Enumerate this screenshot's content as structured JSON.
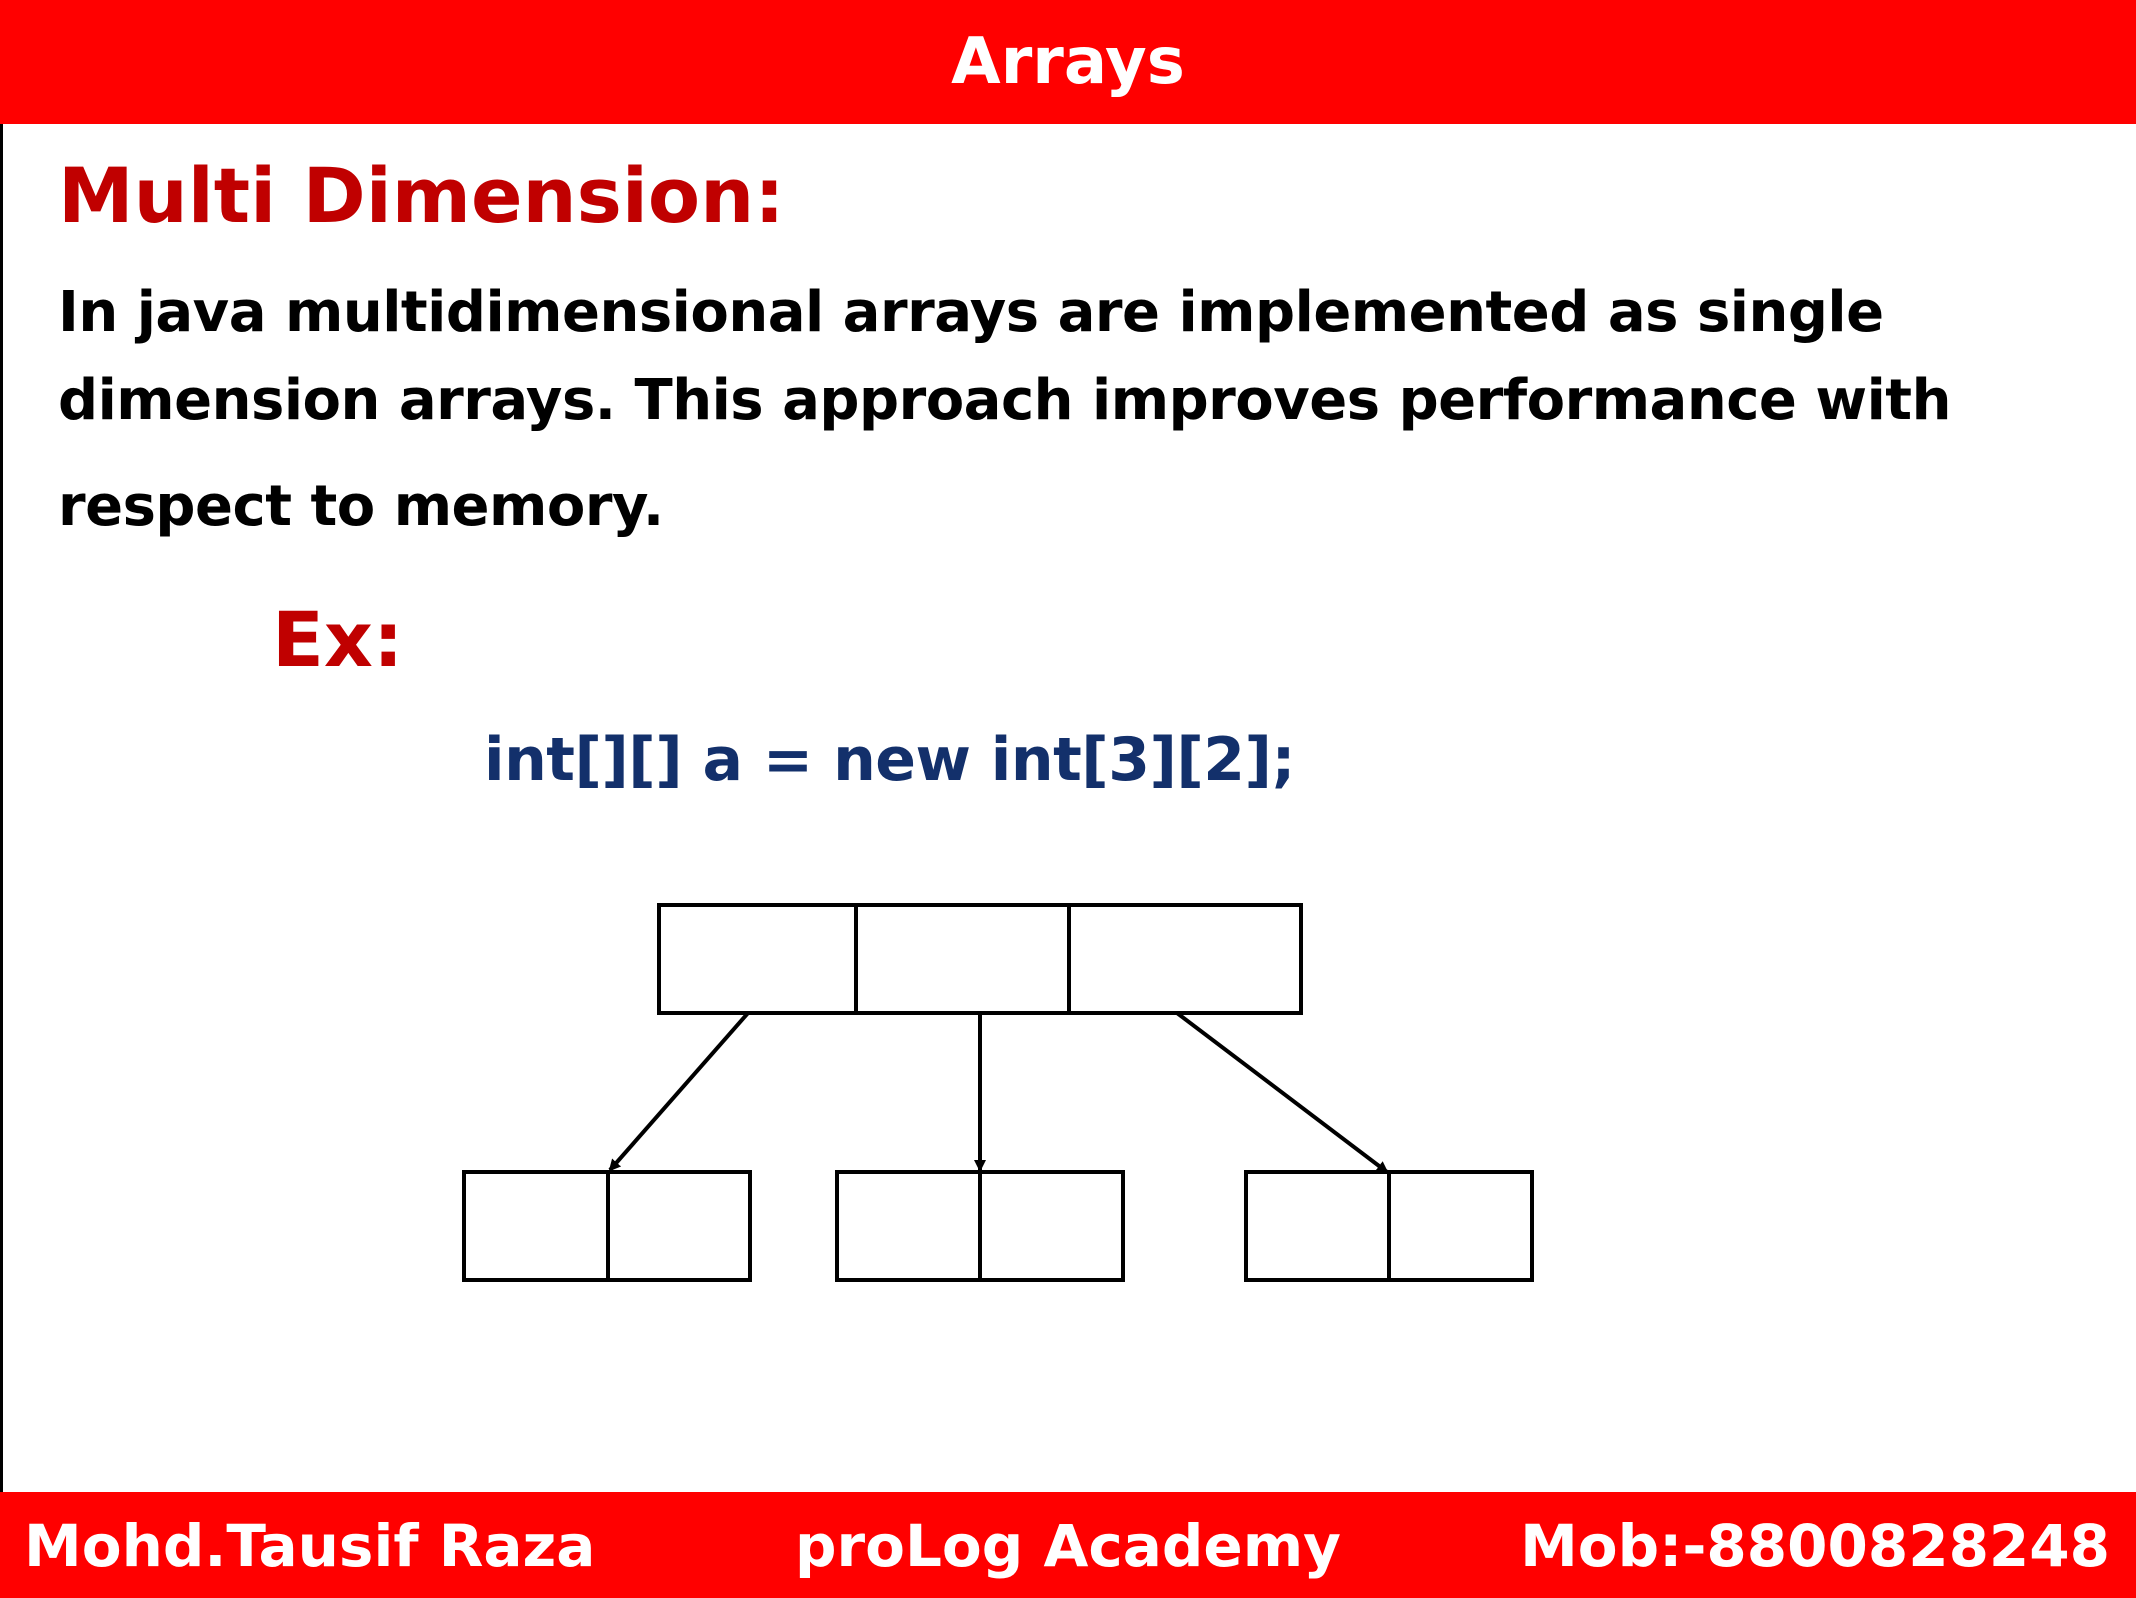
{
  "header": {
    "title": "Arrays"
  },
  "section": {
    "title": "Multi Dimension:",
    "description_lines": [
      "In java multidimensional arrays are implemented as single",
      "dimension arrays. This approach improves performance with",
      "respect to memory."
    ]
  },
  "example": {
    "label": "Ex:",
    "code": "int[][] a = new int[3][2];"
  },
  "diagram": {
    "outer_array_cells": 3,
    "inner_arrays": [
      {
        "cells": 2
      },
      {
        "cells": 2
      },
      {
        "cells": 2
      }
    ]
  },
  "footer": {
    "author": "Mohd.Tausif Raza",
    "academy": "proLog Academy",
    "phone": "Mob:-8800828248"
  },
  "colors": {
    "banner": "#ff0000",
    "heading": "#c00000",
    "code": "#13306b",
    "text": "#000000"
  }
}
